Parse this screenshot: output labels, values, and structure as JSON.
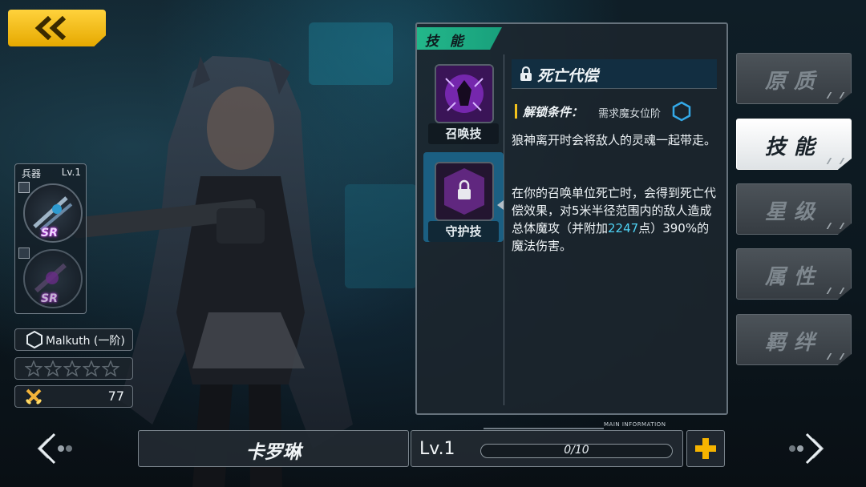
{
  "colors": {
    "accent_teal": "#23b78a",
    "back_button_yellow": "#ffd23c",
    "highlight_blue": "#4fd3f5",
    "unlock_bar_yellow": "#f3c21b",
    "active_skill_bg": "#1b5f82",
    "sr_glow": "#c23de8"
  },
  "icons": {
    "back": "chevron-left-icon",
    "lock": "lock-icon",
    "rank": "hexagon-icon",
    "star": "star-icon",
    "power": "crossed-swords-icon",
    "plus": "plus-icon"
  },
  "weapon_panel": {
    "label": "兵器",
    "level": "Lv.1",
    "slots": [
      {
        "rarity": "SR",
        "state": "equipped"
      },
      {
        "rarity": "SR",
        "state": "dim"
      }
    ]
  },
  "rank": {
    "text": "Malkuth (一阶)"
  },
  "stars": {
    "filled": 0,
    "total": 5
  },
  "power": {
    "value": "77"
  },
  "skill_window": {
    "title": "技 能",
    "skills": [
      {
        "label": "召唤技",
        "active": false
      },
      {
        "label": "守护技",
        "active": true
      }
    ],
    "detail": {
      "name": "死亡代偿",
      "unlock_label": "解锁条件：",
      "unlock_value": "需求魔女位阶",
      "desc_1": "狼神离开时会将敌人的灵魂一起带走。",
      "desc_2_before": "在你的召唤单位死亡时，会得到死亡代偿效果，对5米半径范围内的敌人造成总体魔攻（并附加",
      "desc_2_highlight": "2247",
      "desc_2_after": "点）390%的魔法伤害。"
    }
  },
  "side_tabs": [
    {
      "label": "原质",
      "active": false
    },
    {
      "label": "技能",
      "active": true
    },
    {
      "label": "星级",
      "active": false
    },
    {
      "label": "属性",
      "active": false
    },
    {
      "label": "羁绊",
      "active": false
    }
  ],
  "character": {
    "name": "卡罗琳"
  },
  "level_bar": {
    "level": "Lv.1",
    "exp_text": "0/10",
    "exp_fraction": 0,
    "main_info": "MAIN INFORMATION"
  }
}
